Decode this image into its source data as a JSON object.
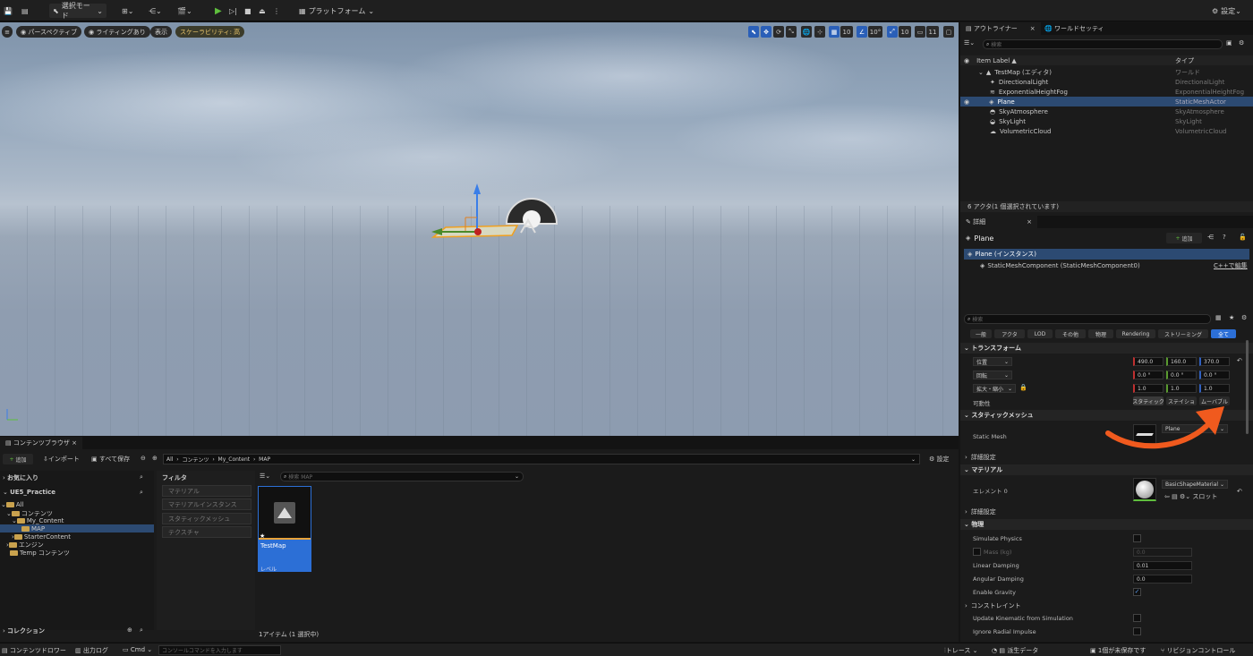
{
  "toolbar": {
    "mode_label": "選択モード",
    "platform_label": "プラットフォーム",
    "settings_label": "設定"
  },
  "viewport": {
    "perspective_label": "パースペクティブ",
    "lighting_label": "ライティングあり",
    "show_label": "表示",
    "scalability_label": "スケーラビリティ: 高",
    "grid_snap_value": "10",
    "rotate_snap_value": "10°",
    "scale_snap_value": "10",
    "camera_speed_value": "11"
  },
  "outliner": {
    "tab_label": "アウトライナー",
    "world_settings_tab": "ワールドセッティ",
    "search_placeholder": "検索",
    "col_label": "Item Label ▲",
    "col_type": "タイプ",
    "items": [
      {
        "label": "TestMap (エディタ)",
        "type": "ワールド"
      },
      {
        "label": "DirectionalLight",
        "type": "DirectionalLight"
      },
      {
        "label": "ExponentialHeightFog",
        "type": "ExponentialHeightFog"
      },
      {
        "label": "Plane",
        "type": "StaticMeshActor"
      },
      {
        "label": "SkyAtmosphere",
        "type": "SkyAtmosphere"
      },
      {
        "label": "SkyLight",
        "type": "SkyLight"
      },
      {
        "label": "VolumetricCloud",
        "type": "VolumetricCloud"
      }
    ],
    "footer": "6 アクタ(1 個選択されています)"
  },
  "details": {
    "tab_label": "詳細",
    "actor_name": "Plane",
    "add_label": "追加",
    "instance_label": "Plane (インスタンス)",
    "component_label": "StaticMeshComponent (StaticMeshComponent0)",
    "edit_cpp_label": "C++で編集",
    "search_placeholder": "検索",
    "filter_tabs": [
      "一般",
      "アクタ",
      "LOD",
      "その他",
      "物理",
      "Rendering",
      "ストリーミング",
      "全て"
    ],
    "transform_header": "トランスフォーム",
    "location_label": "位置",
    "rotation_label": "回転",
    "scale_label": "拡大・縮小",
    "location": [
      "490.0",
      "160.0",
      "370.0"
    ],
    "rotation": [
      "0.0 °",
      "0.0 °",
      "0.0 °"
    ],
    "scale": [
      "1.0",
      "1.0",
      "1.0"
    ],
    "mobility_label": "可動性",
    "mobility_options": [
      "スタティック",
      "ステイショ",
      "ムーバブル"
    ],
    "static_mesh_header": "スタティックメッシュ",
    "static_mesh_label": "Static Mesh",
    "static_mesh_value": "Plane",
    "advanced_label": "詳細設定",
    "materials_header": "マテリアル",
    "element_label": "エレメント 0",
    "material_value": "BasicShapeMaterial",
    "slot_label": "スロット",
    "advanced_label2": "詳細設定",
    "physics_header": "物理",
    "simulate_physics": "Simulate Physics",
    "mass_label": "Mass (kg)",
    "mass_value": "0.0",
    "linear_damping_label": "Linear Damping",
    "linear_damping_value": "0.01",
    "angular_damping_label": "Angular Damping",
    "angular_damping_value": "0.0",
    "enable_gravity_label": "Enable Gravity",
    "constraints_label": "コンストレイント",
    "update_kinematic_label": "Update Kinematic from Simulation",
    "ignore_radial_label": "Ignore Radial Impulse"
  },
  "content_browser": {
    "tab_label": "コンテンツブラウザ",
    "add_label": "追加",
    "import_label": "インポート",
    "save_all_label": "すべて保存",
    "breadcrumb": [
      "All",
      "コンテンツ",
      "My_Content",
      "MAP"
    ],
    "settings_label": "設定",
    "favorites_label": "お気に入り",
    "project_label": "UE5_Practice",
    "tree": [
      "All",
      "コンテンツ",
      "My_Content",
      "MAP",
      "StarterContent",
      "エンジン",
      "Temp コンテンツ"
    ],
    "filter_header": "フィルタ",
    "filters": [
      "マテリアル",
      "マテリアルインスタンス",
      "スタティックメッシュ",
      "テクスチャ"
    ],
    "search_placeholder": "検索 MAP",
    "asset_name": "TestMap",
    "asset_type": "レベル",
    "item_count": "1アイテム (1 選択中)",
    "collections_label": "コレクション"
  },
  "statusbar": {
    "content_drawer": "コンテンツドロワー",
    "output_log": "出力ログ",
    "cmd_label": "Cmd",
    "console_placeholder": "コンソールコマンドを入力します",
    "trace_label": "トレース",
    "derived_data": "派生データ",
    "unsaved": "1個が未保存です",
    "source_control": "リビジョンコントロール"
  },
  "colors": {
    "accent_blue": "#2c6fd6",
    "selection": "#2c4a72",
    "play_green": "#5fbf3d",
    "arrow_orange": "#f05a1e"
  }
}
